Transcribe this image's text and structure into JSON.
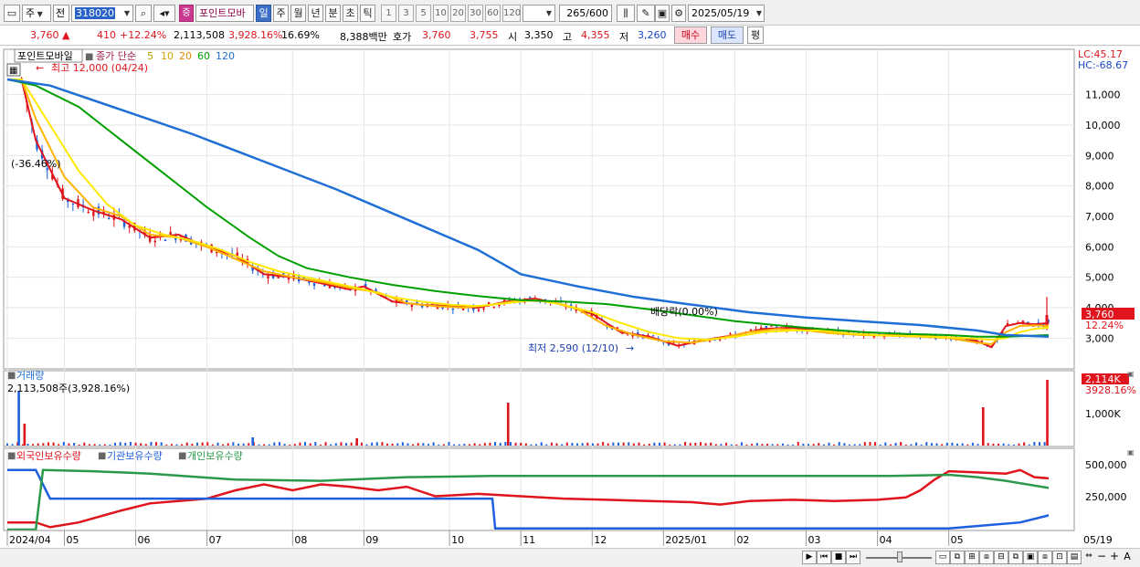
{
  "toolbar": {
    "period_select": "주",
    "prev_label": "전",
    "code": "318020",
    "stock_name": "포인트모바",
    "badge_label": "증",
    "periods": [
      "일",
      "주",
      "월",
      "년",
      "분",
      "초",
      "틱"
    ],
    "minute_options": [
      "1",
      "3",
      "5",
      "10",
      "20",
      "30",
      "60",
      "120"
    ],
    "count": "265",
    "count_total": "/600",
    "date": "2025/05/19",
    "icon_names": [
      "chart-type-icon",
      "search-icon",
      "sound-icon",
      "candle-icon",
      "edit-icon",
      "save-icon",
      "settings-icon"
    ]
  },
  "quote": {
    "price": "3,760",
    "change": "410",
    "change_pct": "+12.24%",
    "volume": "2,113,508",
    "volume_pct": "3,928.16%",
    "turnover_pct": "16.69%",
    "amount": "8,388백만",
    "bid_label": "호가",
    "ask_price": "3,760",
    "bid_price": "3,755",
    "open_label": "시",
    "open": "3,350",
    "high_label": "고",
    "high": "4,355",
    "low_label": "저",
    "low": "3,260",
    "buy_label": "매수",
    "sell_label": "매도",
    "eval_label": "평"
  },
  "legend": {
    "name": "포인트모바일",
    "ma_label": "종가 단순",
    "ma": [
      "5",
      "10",
      "20",
      "60",
      "120"
    ],
    "ma_colors": [
      "#ffe800",
      "#ffb300",
      "#e58b00",
      "#00a000",
      "#1e6fd6"
    ]
  },
  "annotations": {
    "high_label": "최고 12,000 (04/24)",
    "pct_label": "(-36.46%)",
    "ex_div_label": "배당락(0.00%)",
    "low_label": "최저 2,590 (12/10)"
  },
  "scale": {
    "lc": "LC:45.17",
    "hc": "HC:-68.67",
    "price_ticks": [
      "11,000",
      "10,000",
      "9,000",
      "8,000",
      "7,000",
      "6,000",
      "5,000",
      "4,000",
      "3,000"
    ],
    "current_price": "3,760",
    "current_pct": "12.24%",
    "volume_label": "1,000K",
    "volume_current": "2,114K",
    "volume_pct": "3928.16%",
    "holding_ticks": [
      "500,000",
      "250,000"
    ]
  },
  "volume_pane": {
    "title": "거래량",
    "value_label": "2,113,508주(3,928.16%)"
  },
  "holding_pane": {
    "labels": [
      "외국인보유수량",
      "기관보유수량",
      "개인보유수량"
    ],
    "colors": [
      "#e0141c",
      "#1e5fe0",
      "#2a9a4a"
    ]
  },
  "x_axis": {
    "labels": [
      "2024/04",
      "05",
      "06",
      "07",
      "08",
      "09",
      "10",
      "11",
      "12",
      "2025/01",
      "02",
      "03",
      "04",
      "05",
      "05/19"
    ]
  },
  "chart_data": {
    "type": "line",
    "title": "포인트모바일",
    "price_ylim": [
      2400,
      12000
    ],
    "price_series": [
      {
        "name": "5",
        "color": "#e0141c",
        "points": [
          [
            0,
            11500
          ],
          [
            1,
            11500
          ],
          [
            2,
            9500
          ],
          [
            4,
            7600
          ],
          [
            6,
            7200
          ],
          [
            8,
            6900
          ],
          [
            10,
            6300
          ],
          [
            12,
            6400
          ],
          [
            14,
            6000
          ],
          [
            16,
            5700
          ],
          [
            18,
            5100
          ],
          [
            20,
            5000
          ],
          [
            22,
            4800
          ],
          [
            24,
            4600
          ],
          [
            25,
            4700
          ],
          [
            27,
            4200
          ],
          [
            29,
            4100
          ],
          [
            31,
            4050
          ],
          [
            33,
            4000
          ],
          [
            35,
            4200
          ],
          [
            37,
            4300
          ],
          [
            39,
            4100
          ],
          [
            41,
            3800
          ],
          [
            43,
            3200
          ],
          [
            45,
            3050
          ],
          [
            47,
            2750
          ],
          [
            49,
            2950
          ],
          [
            51,
            3100
          ],
          [
            53,
            3300
          ],
          [
            55,
            3350
          ],
          [
            57,
            3250
          ],
          [
            59,
            3150
          ],
          [
            61,
            3100
          ],
          [
            63,
            3100
          ],
          [
            65,
            3050
          ],
          [
            67,
            3000
          ],
          [
            68,
            2900
          ],
          [
            69,
            2700
          ],
          [
            70,
            3400
          ],
          [
            71,
            3500
          ],
          [
            72,
            3450
          ],
          [
            73,
            3500
          ]
        ]
      },
      {
        "name": "10",
        "color": "#ffb300",
        "points": [
          [
            0,
            11500
          ],
          [
            1,
            11500
          ],
          [
            2,
            10200
          ],
          [
            4,
            8300
          ],
          [
            6,
            7300
          ],
          [
            8,
            7000
          ],
          [
            10,
            6400
          ],
          [
            12,
            6300
          ],
          [
            14,
            6000
          ],
          [
            16,
            5600
          ],
          [
            18,
            5200
          ],
          [
            20,
            5000
          ],
          [
            22,
            4850
          ],
          [
            24,
            4650
          ],
          [
            26,
            4500
          ],
          [
            28,
            4150
          ],
          [
            30,
            4050
          ],
          [
            32,
            4000
          ],
          [
            34,
            4100
          ],
          [
            36,
            4250
          ],
          [
            38,
            4200
          ],
          [
            40,
            3950
          ],
          [
            42,
            3400
          ],
          [
            44,
            3100
          ],
          [
            46,
            2900
          ],
          [
            48,
            2850
          ],
          [
            50,
            3000
          ],
          [
            52,
            3200
          ],
          [
            54,
            3300
          ],
          [
            56,
            3250
          ],
          [
            58,
            3150
          ],
          [
            60,
            3100
          ],
          [
            62,
            3080
          ],
          [
            64,
            3050
          ],
          [
            66,
            3000
          ],
          [
            68,
            2850
          ],
          [
            69,
            2800
          ],
          [
            70,
            3200
          ],
          [
            71,
            3400
          ],
          [
            72,
            3420
          ],
          [
            73,
            3400
          ]
        ]
      },
      {
        "name": "20",
        "color": "#ffe800",
        "points": [
          [
            0,
            11500
          ],
          [
            1,
            11500
          ],
          [
            3,
            10000
          ],
          [
            5,
            8500
          ],
          [
            7,
            7400
          ],
          [
            9,
            6700
          ],
          [
            11,
            6400
          ],
          [
            13,
            6200
          ],
          [
            15,
            5900
          ],
          [
            17,
            5500
          ],
          [
            19,
            5200
          ],
          [
            21,
            5000
          ],
          [
            23,
            4800
          ],
          [
            25,
            4600
          ],
          [
            27,
            4350
          ],
          [
            29,
            4200
          ],
          [
            31,
            4100
          ],
          [
            33,
            4050
          ],
          [
            35,
            4150
          ],
          [
            37,
            4250
          ],
          [
            39,
            4100
          ],
          [
            41,
            3850
          ],
          [
            43,
            3500
          ],
          [
            45,
            3200
          ],
          [
            47,
            3000
          ],
          [
            49,
            2950
          ],
          [
            51,
            3050
          ],
          [
            53,
            3200
          ],
          [
            55,
            3250
          ],
          [
            57,
            3250
          ],
          [
            59,
            3150
          ],
          [
            61,
            3100
          ],
          [
            63,
            3080
          ],
          [
            65,
            3050
          ],
          [
            67,
            3000
          ],
          [
            69,
            2950
          ],
          [
            70,
            3000
          ],
          [
            71,
            3200
          ],
          [
            72,
            3300
          ],
          [
            73,
            3350
          ]
        ]
      },
      {
        "name": "60",
        "color": "#00a000",
        "points": [
          [
            0,
            11500
          ],
          [
            2,
            11300
          ],
          [
            5,
            10600
          ],
          [
            8,
            9500
          ],
          [
            11,
            8400
          ],
          [
            14,
            7300
          ],
          [
            17,
            6300
          ],
          [
            19,
            5700
          ],
          [
            21,
            5300
          ],
          [
            24,
            5000
          ],
          [
            27,
            4750
          ],
          [
            30,
            4550
          ],
          [
            33,
            4380
          ],
          [
            36,
            4250
          ],
          [
            39,
            4200
          ],
          [
            42,
            4120
          ],
          [
            45,
            3950
          ],
          [
            48,
            3750
          ],
          [
            51,
            3560
          ],
          [
            54,
            3420
          ],
          [
            57,
            3300
          ],
          [
            60,
            3200
          ],
          [
            63,
            3140
          ],
          [
            66,
            3100
          ],
          [
            68,
            3050
          ],
          [
            70,
            3050
          ],
          [
            73,
            3100
          ]
        ]
      },
      {
        "name": "120",
        "color": "#1e6fd6",
        "points": [
          [
            0,
            11500
          ],
          [
            3,
            11300
          ],
          [
            8,
            10500
          ],
          [
            13,
            9700
          ],
          [
            18,
            8800
          ],
          [
            23,
            7900
          ],
          [
            28,
            6900
          ],
          [
            33,
            5900
          ],
          [
            36,
            5100
          ],
          [
            40,
            4700
          ],
          [
            44,
            4350
          ],
          [
            48,
            4100
          ],
          [
            52,
            3850
          ],
          [
            56,
            3680
          ],
          [
            60,
            3550
          ],
          [
            64,
            3430
          ],
          [
            68,
            3250
          ],
          [
            70,
            3100
          ],
          [
            73,
            3050
          ]
        ]
      }
    ],
    "volume_ylim": [
      0,
      2200
    ],
    "holding_ylim": [
      0,
      560000
    ],
    "holding_series": [
      {
        "name": "외국인보유수량",
        "color": "#e0141c",
        "points": [
          [
            0,
            60000
          ],
          [
            2,
            60000
          ],
          [
            3,
            20000
          ],
          [
            5,
            60000
          ],
          [
            8,
            160000
          ],
          [
            10,
            220000
          ],
          [
            12,
            240000
          ],
          [
            14,
            260000
          ],
          [
            16,
            330000
          ],
          [
            18,
            380000
          ],
          [
            20,
            330000
          ],
          [
            22,
            380000
          ],
          [
            24,
            360000
          ],
          [
            26,
            330000
          ],
          [
            28,
            360000
          ],
          [
            30,
            280000
          ],
          [
            33,
            300000
          ],
          [
            36,
            280000
          ],
          [
            39,
            260000
          ],
          [
            42,
            250000
          ],
          [
            45,
            240000
          ],
          [
            48,
            230000
          ],
          [
            50,
            210000
          ],
          [
            52,
            240000
          ],
          [
            55,
            250000
          ],
          [
            58,
            240000
          ],
          [
            61,
            250000
          ],
          [
            63,
            270000
          ],
          [
            64,
            330000
          ],
          [
            65,
            420000
          ],
          [
            66,
            490000
          ],
          [
            68,
            480000
          ],
          [
            70,
            470000
          ],
          [
            71,
            500000
          ],
          [
            72,
            440000
          ],
          [
            73,
            430000
          ]
        ]
      },
      {
        "name": "기관보유수량",
        "color": "#1e5fe0",
        "points": [
          [
            0,
            500000
          ],
          [
            2,
            500000
          ],
          [
            3,
            260000
          ],
          [
            12,
            260000
          ],
          [
            20,
            260000
          ],
          [
            28,
            260000
          ],
          [
            34,
            260000
          ],
          [
            34.2,
            10000
          ],
          [
            44,
            10000
          ],
          [
            56,
            10000
          ],
          [
            66,
            10000
          ],
          [
            68,
            30000
          ],
          [
            71,
            60000
          ],
          [
            73,
            120000
          ]
        ]
      },
      {
        "name": "개인보유수량",
        "color": "#2a9a4a",
        "points": [
          [
            0,
            0
          ],
          [
            2,
            0
          ],
          [
            2.5,
            500000
          ],
          [
            6,
            490000
          ],
          [
            10,
            470000
          ],
          [
            16,
            420000
          ],
          [
            22,
            410000
          ],
          [
            28,
            440000
          ],
          [
            34,
            450000
          ],
          [
            40,
            450000
          ],
          [
            46,
            450000
          ],
          [
            52,
            450000
          ],
          [
            58,
            450000
          ],
          [
            62,
            450000
          ],
          [
            66,
            460000
          ],
          [
            68,
            440000
          ],
          [
            70,
            410000
          ],
          [
            73,
            350000
          ]
        ]
      }
    ]
  }
}
